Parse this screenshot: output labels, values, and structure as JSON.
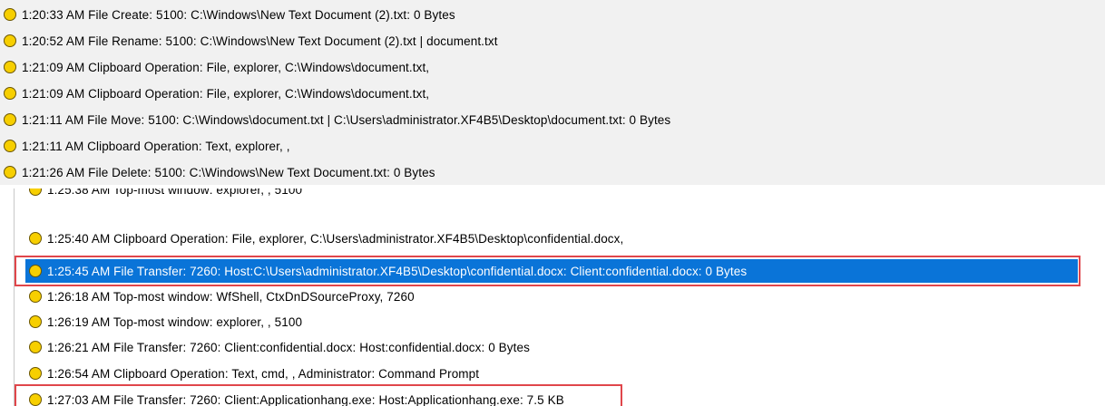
{
  "panel1": {
    "rows": [
      "1:20:33 AM  File Create: 5100: C:\\Windows\\New Text Document (2).txt: 0 Bytes",
      "1:20:52 AM  File Rename: 5100: C:\\Windows\\New Text Document (2).txt | document.txt",
      "1:21:09 AM   Clipboard Operation: File, explorer, C:\\Windows\\document.txt,",
      "1:21:09 AM   Clipboard Operation: File, explorer, C:\\Windows\\document.txt,",
      "1:21:11 AM   File Move: 5100: C:\\Windows\\document.txt | C:\\Users\\administrator.XF4B5\\Desktop\\document.txt:  0 Bytes",
      "1:21:11 AM   Clipboard Operation: Text, explorer, ,",
      "1:21:26 AM  File Delete: 5100: C:\\Windows\\New Text Document.txt: 0 Bytes"
    ]
  },
  "panel2": {
    "partial_row": "1:25:38 AM   Top-most window: explorer, , 5100",
    "rows": [
      "1:25:40  AM   Clipboard  Operation:  File,  explorer,  C:\\Users\\administrator.XF4B5\\Desktop\\confidential.docx,",
      "1:25:45  AM    File  Transfer:  7260:  Host:C:\\Users\\administrator.XF4B5\\Desktop\\confidential.docx:  Client:confidential.docx:  0  Bytes",
      "1:26:18 AM   Top-most window: WfShell, CtxDnDSourceProxy, 7260",
      "1:26:19 AM  Top-most window: explorer, , 5100",
      "1:26:21  AM   File  Transfer:  7260:  Client:confidential.docx:  Host:confidential.docx:  0  Bytes",
      "1:26:54  AM   Clipboard  Operation:  Text,  cmd,  ,  Administrator:  Command  Prompt",
      "1:27:03  AM    File  Transfer:  7260:  Client:Applicationhang.exe:  Host:Applicationhang.exe:  7.5  KB"
    ],
    "selected_index": 1
  },
  "colors": {
    "selection": "#0a74d8",
    "highlight_box": "#e0464b",
    "event_dot": "#f7cf00"
  },
  "icons": {
    "event": "yellow-circle-icon"
  }
}
